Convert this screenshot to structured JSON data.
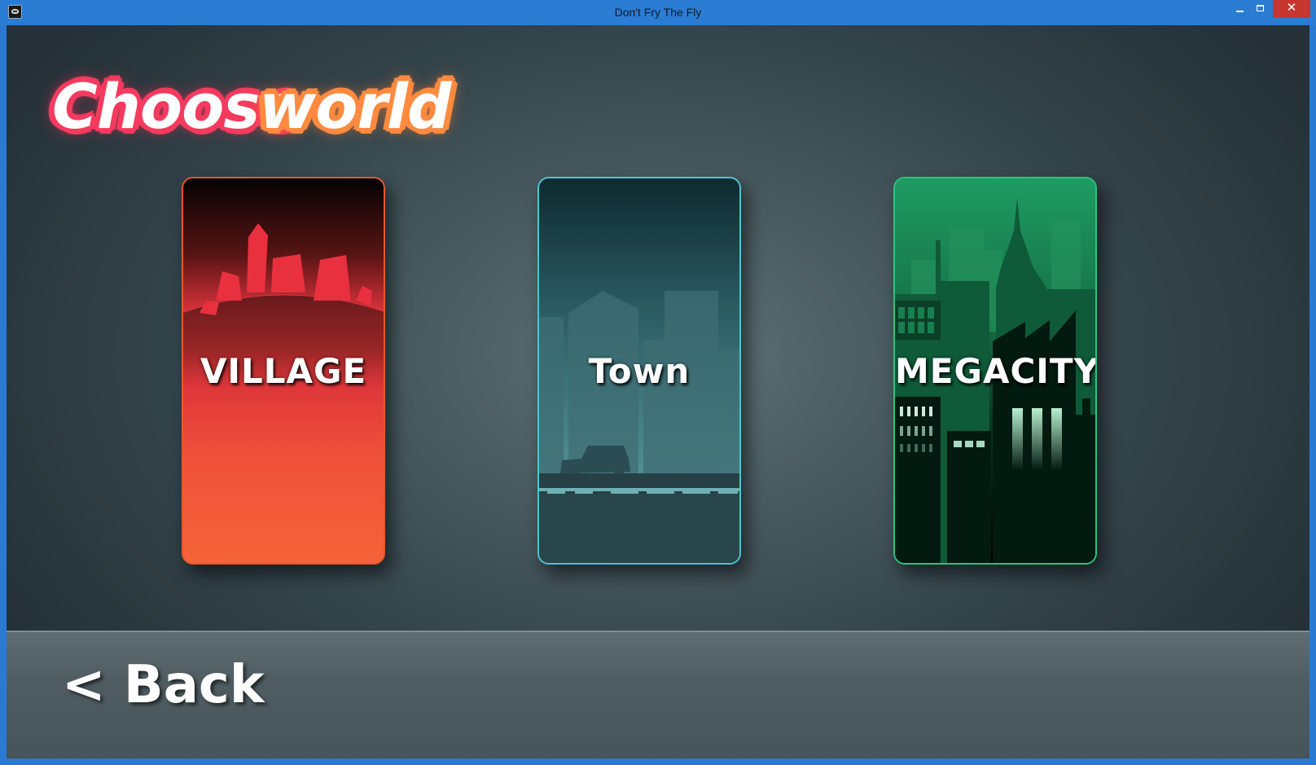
{
  "window": {
    "title": "Don't Fry The Fly",
    "minimize_glyph": "",
    "maximize_glyph": "",
    "close_glyph": "✕"
  },
  "heading": {
    "word_1": "Choose",
    "word_2": "world",
    "word_1_color": "#f43a5e",
    "word_2_color": "#ff8a40"
  },
  "worlds": [
    {
      "label": "VILLAGE",
      "border_color": "#e8572a",
      "theme": "red-orange"
    },
    {
      "label": "Town",
      "border_color": "#4fc3d0",
      "theme": "teal"
    },
    {
      "label": "MEGACITY",
      "border_color": "#2ec27e",
      "theme": "green"
    }
  ],
  "footer": {
    "back_label": "< Back"
  }
}
